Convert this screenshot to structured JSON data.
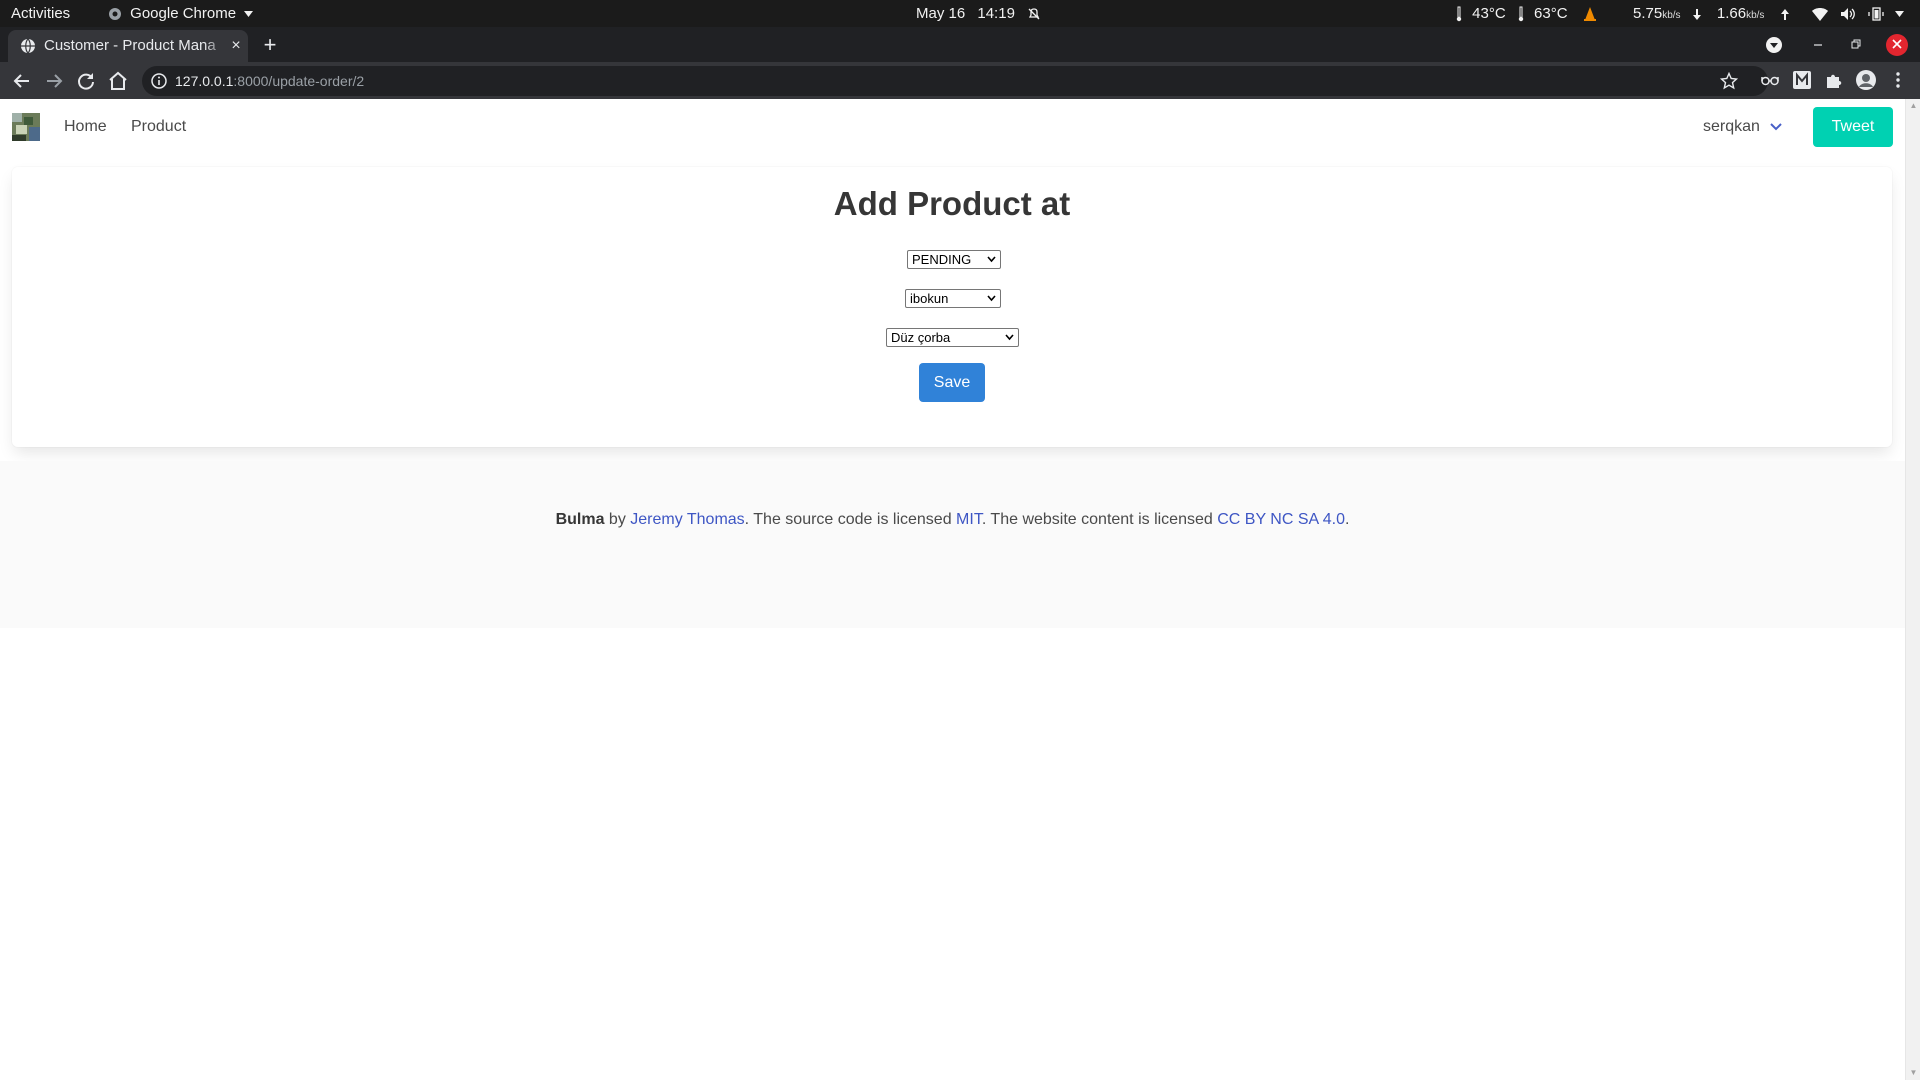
{
  "system_bar": {
    "activities": "Activities",
    "app_name": "Google Chrome",
    "date": "May 16",
    "time": "14:19",
    "temp1": "43°C",
    "temp2": "63°C",
    "net_down": "5.75",
    "net_down_unit": "kb/s",
    "net_up": "1.66",
    "net_up_unit": "kb/s"
  },
  "browser": {
    "tab_title": "Customer - Product Mana",
    "url_host": "127.0.0.1",
    "url_path": ":8000/update-order/2",
    "new_tab": "+",
    "close_tab": "×"
  },
  "navbar": {
    "links": [
      "Home",
      "Product"
    ],
    "user": "serqkan",
    "tweet": "Tweet"
  },
  "form": {
    "heading": "Add Product at",
    "status_value": "PENDING",
    "customer_value": "ibokun",
    "product_value": "Düz çorba",
    "save": "Save"
  },
  "footer": {
    "brand": "Bulma",
    "by": " by ",
    "author": "Jeremy Thomas",
    "t1": ". The source code is licensed ",
    "license_code": "MIT",
    "t2": ". The website content is licensed ",
    "license_content": "CC BY NC SA 4.0",
    "t3": "."
  },
  "colors": {
    "primary": "#00d1b2",
    "link": "#3e56c4",
    "save": "#3082d8"
  }
}
